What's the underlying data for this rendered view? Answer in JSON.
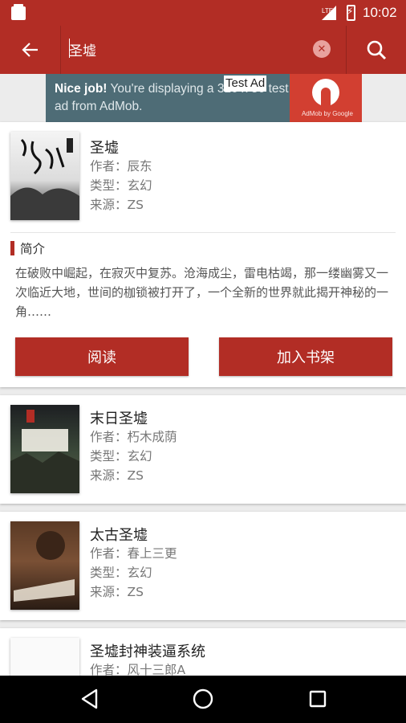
{
  "status_bar": {
    "time": "10:02",
    "network_label": "LTE"
  },
  "toolbar": {
    "search_query": "圣墟"
  },
  "ad": {
    "headline": "Nice job!",
    "body": "You're displaying a 320 x 50 test ad from AdMob.",
    "badge": "Test Ad",
    "logo_caption": "AdMob by Google"
  },
  "featured": {
    "title": "圣墟",
    "author": "作者：辰东",
    "genre": "类型：玄幻",
    "source": "来源：ZS",
    "intro_label": "简介",
    "intro_text": "在破败中崛起，在寂灭中复苏。沧海成尘，雷电枯竭，那一缕幽雾又一次临近大地，世间的枷锁被打开了，一个全新的世界就此揭开神秘的一角……",
    "read_button": "阅读",
    "add_button": "加入书架"
  },
  "results": [
    {
      "title": "末日圣墟",
      "author": "作者：朽木成荫",
      "genre": "类型：玄幻",
      "source": "来源：ZS"
    },
    {
      "title": "太古圣墟",
      "author": "作者：春上三更",
      "genre": "类型：玄幻",
      "source": "来源：ZS"
    },
    {
      "title": "圣墟封神装逼系统",
      "author": "作者：风十三郎A"
    }
  ],
  "colors": {
    "primary": "#b22d25",
    "background": "#ececec",
    "ad_background": "#4e6c76",
    "ad_logo": "#d23f31"
  }
}
